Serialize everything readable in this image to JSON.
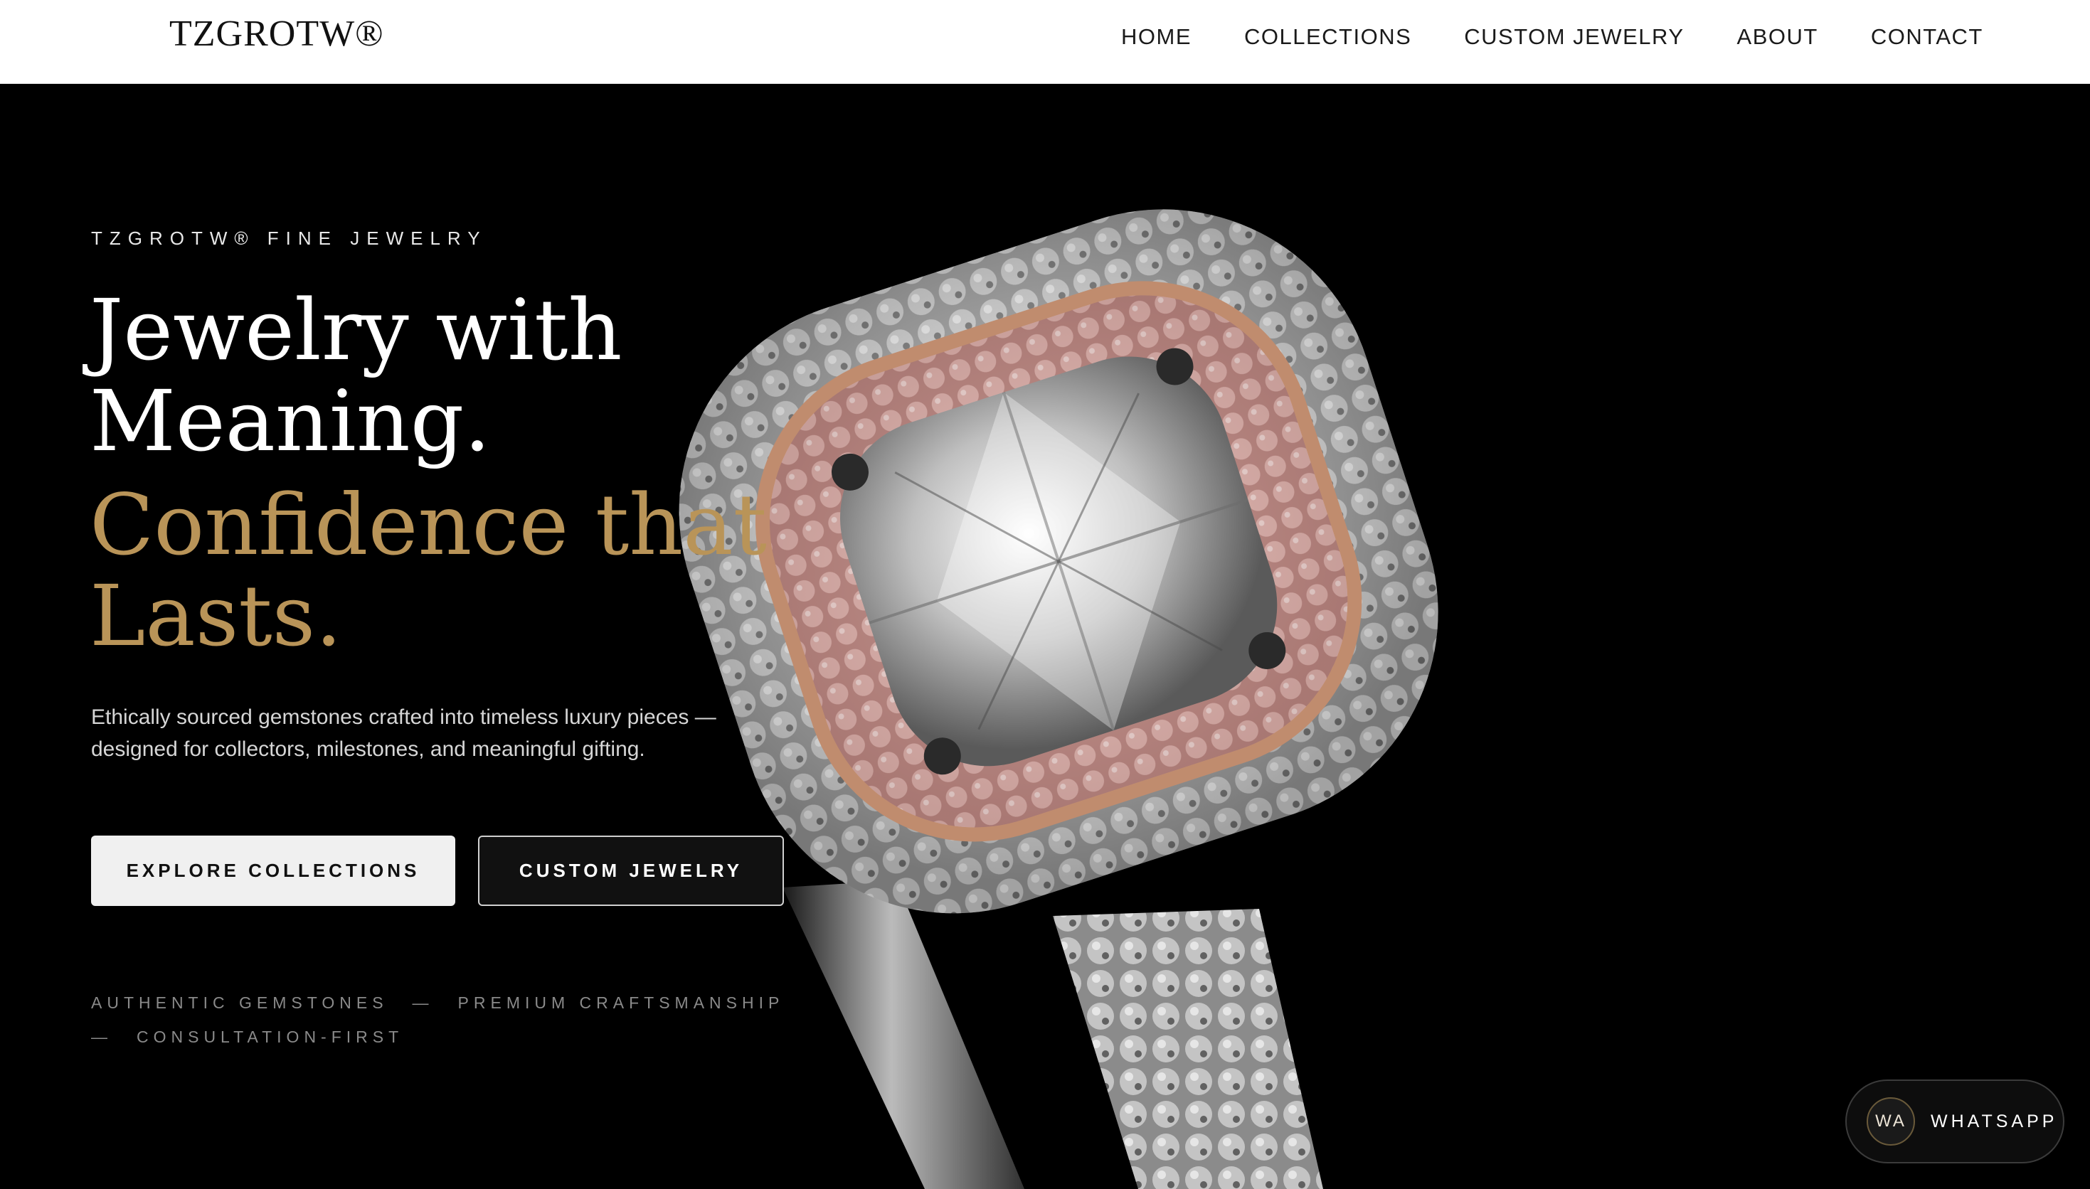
{
  "nav": {
    "logo": "TZGROTW®",
    "items": [
      "HOME",
      "COLLECTIONS",
      "CUSTOM JEWELRY",
      "ABOUT",
      "CONTACT"
    ]
  },
  "hero": {
    "eyebrow": "TZGROTW® FINE JEWELRY",
    "headline_line1": "Jewelry with",
    "headline_line2": "Meaning.",
    "accent_line1": "Confidence that",
    "accent_line2": "Lasts.",
    "subtext": "Ethically sourced gemstones crafted into timeless luxury pieces — designed for collectors, milestones, and meaningful gifting.",
    "primary_button": "EXPLORE COLLECTIONS",
    "secondary_button": "CUSTOM JEWELRY",
    "trust_1": "AUTHENTIC GEMSTONES",
    "trust_2": "PREMIUM CRAFTSMANSHIP",
    "trust_3": "CONSULTATION-FIRST",
    "separator": "—"
  },
  "whatsapp": {
    "badge": "WA",
    "label": "WHATSAPP"
  },
  "colors": {
    "accent_gold": "#b99458",
    "background": "#000000",
    "nav_bg": "#ffffff"
  }
}
